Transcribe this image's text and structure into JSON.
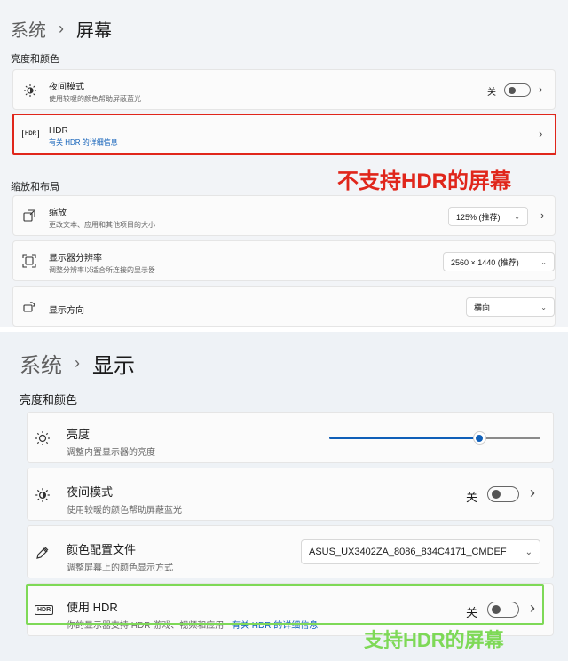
{
  "top": {
    "breadcrumb": "系统",
    "page_title": "屏幕",
    "section1": "亮度和颜色",
    "night": {
      "title": "夜间模式",
      "sub": "使用较暖的颜色帮助屏蔽蓝光",
      "state": "关"
    },
    "hdr": {
      "title": "HDR",
      "link": "有关 HDR 的详细信息"
    },
    "annotation": "不支持HDR的屏幕",
    "section2": "缩放和布局",
    "scale": {
      "title": "缩放",
      "sub": "更改文本、应用和其他项目的大小",
      "value": "125% (推荐)"
    },
    "resolution": {
      "title": "显示器分辨率",
      "sub": "调整分辨率以适合所连接的显示器",
      "value": "2560 × 1440 (推荐)"
    },
    "orientation": {
      "title": "显示方向",
      "value": "横向"
    }
  },
  "bottom": {
    "breadcrumb": "系统",
    "page_title": "显示",
    "section1": "亮度和颜色",
    "brightness": {
      "title": "亮度",
      "sub": "调整内置显示器的亮度",
      "level": 0.71
    },
    "night": {
      "title": "夜间模式",
      "sub": "使用较暖的颜色帮助屏蔽蓝光",
      "state": "关"
    },
    "profile": {
      "title": "颜色配置文件",
      "sub": "调整屏幕上的颜色显示方式",
      "value": "ASUS_UX3402ZA_8086_834C4171_CMDEF"
    },
    "hdr": {
      "title": "使用 HDR",
      "sub": "你的显示器支持 HDR 游戏、视频和应用",
      "link": "有关 HDR 的详细信息",
      "state": "关"
    },
    "annotation": "支持HDR的屏幕"
  },
  "icons": {
    "sun": "sun-icon",
    "night": "night-light-icon",
    "hdr": "hdr-icon",
    "scale": "scale-icon",
    "resolution": "resolution-icon",
    "orientation": "orientation-icon",
    "pen": "color-profile-icon",
    "chevron": "chevron-right-icon",
    "dropdown": "chevron-down-icon"
  },
  "colors": {
    "annotation_red": "#e0261b",
    "annotation_green": "#7ed957",
    "link_blue": "#0f5fb8",
    "slider_blue": "#0f5fb8"
  }
}
